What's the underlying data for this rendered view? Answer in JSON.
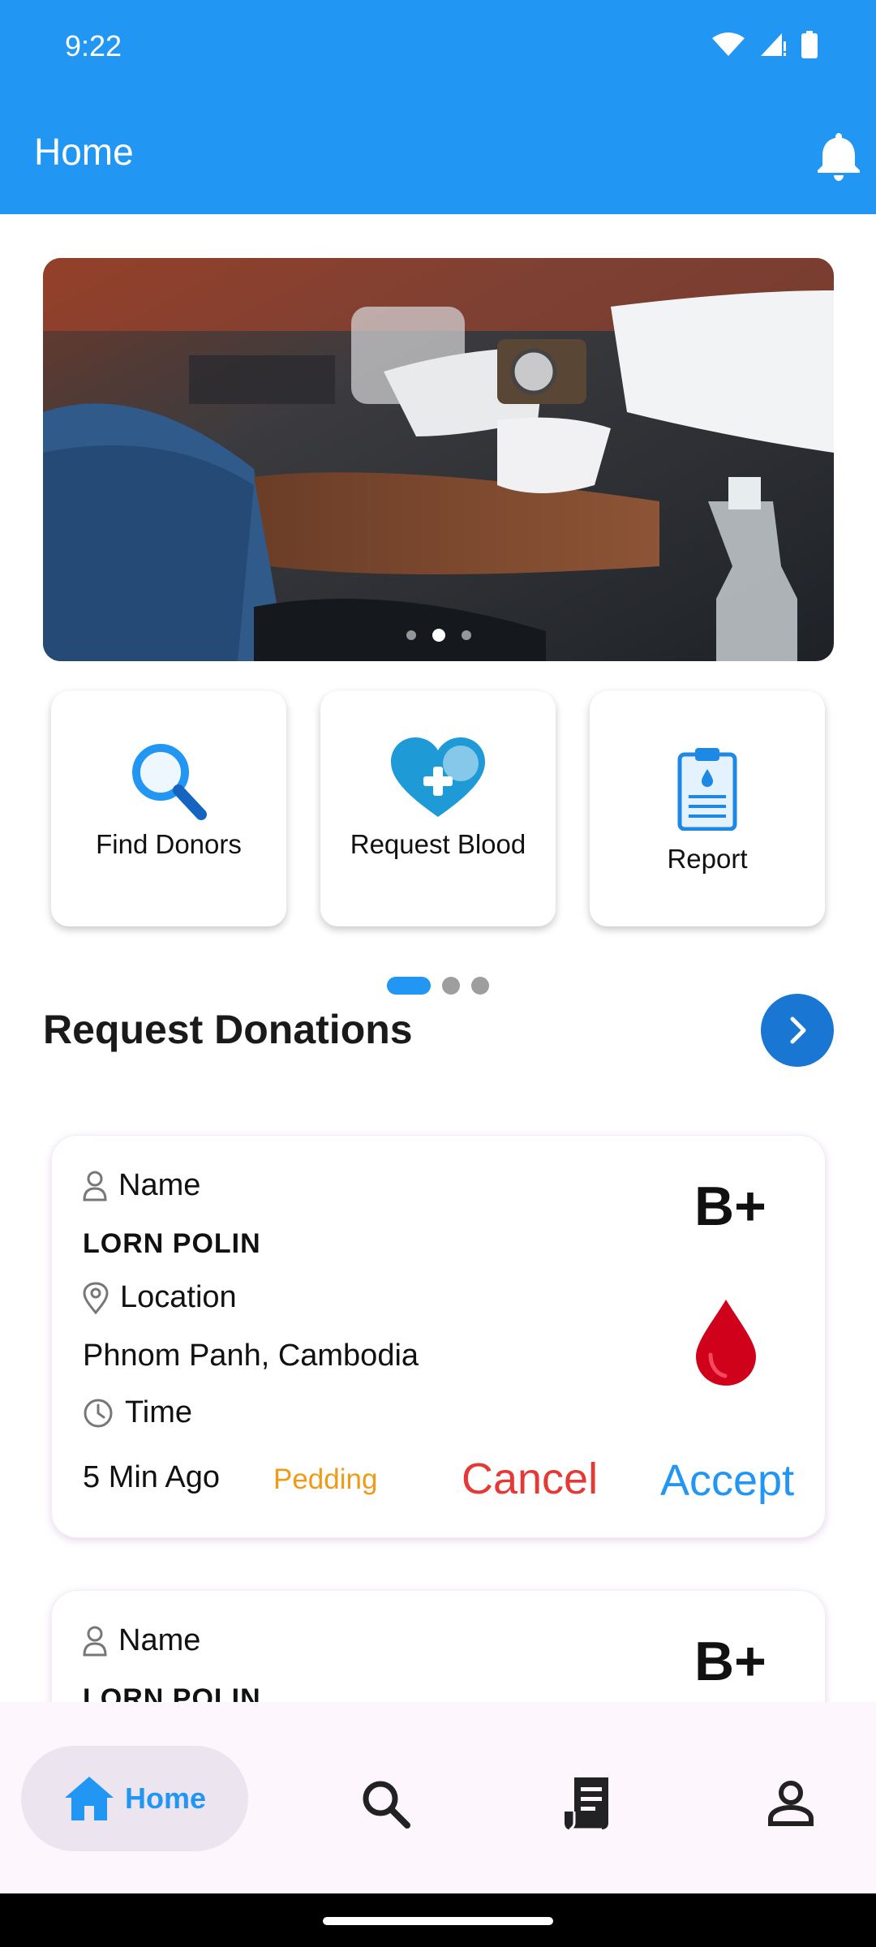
{
  "status_bar": {
    "time": "9:22"
  },
  "app_bar": {
    "title": "Home",
    "icon": "bell-icon"
  },
  "banner": {
    "slides": 3,
    "active_slide": 2
  },
  "quick_actions": [
    {
      "label": "Find Donors",
      "icon": "search-icon"
    },
    {
      "label": "Request Blood",
      "icon": "heart-plus-icon"
    },
    {
      "label": "Report",
      "icon": "clipboard-icon"
    }
  ],
  "section": {
    "title": "Request Donations"
  },
  "requests": [
    {
      "name_label": "Name",
      "name": "LORN POLIN",
      "location_label": "Location",
      "location": "Phnom Panh, Cambodia",
      "time_label": "Time",
      "time": "5 Min Ago",
      "status": "Pedding",
      "blood_type": "B+",
      "cancel_label": "Cancel",
      "accept_label": "Accept"
    },
    {
      "name_label": "Name",
      "name": "LORN POLIN",
      "blood_type": "B+"
    }
  ],
  "bottom_nav": {
    "home_label": "Home"
  },
  "colors": {
    "primary": "#2196f3",
    "cancel": "#e53935",
    "status": "#f09a16",
    "blood": "#d32f2f"
  }
}
